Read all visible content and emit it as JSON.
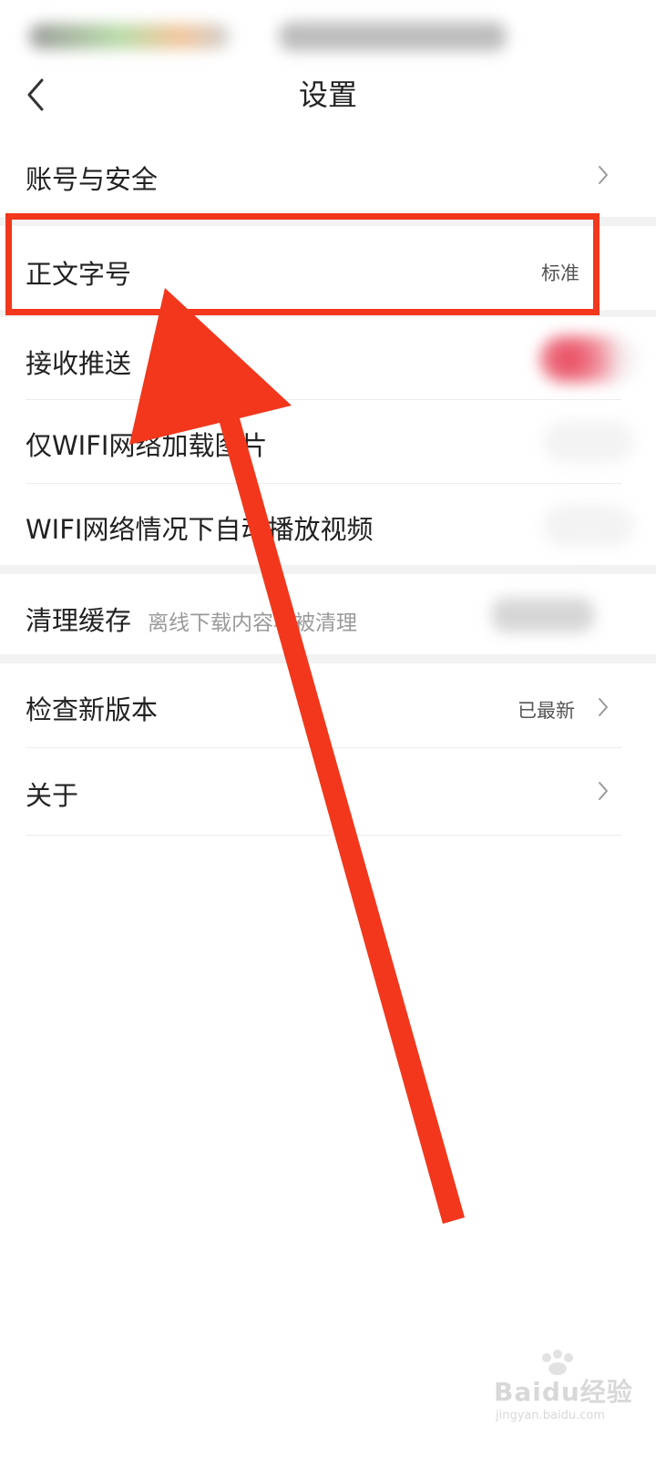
{
  "header": {
    "title": "设置"
  },
  "settings": {
    "account": {
      "label": "账号与安全"
    },
    "font_size": {
      "label": "正文字号",
      "value": "标准"
    },
    "push": {
      "label": "接收推送"
    },
    "wifi_images": {
      "label": "仅WIFI网络加载图片"
    },
    "wifi_video": {
      "label": "WIFI网络情况下自动播放视频"
    },
    "clear_cache": {
      "label": "清理缓存",
      "note": "离线下载内容将被清理"
    },
    "check_update": {
      "label": "检查新版本",
      "value": "已最新"
    },
    "about": {
      "label": "关于"
    }
  },
  "watermark": {
    "main": "Baidu经验",
    "sub": "jingyan.baidu.com"
  },
  "colors": {
    "annotation_red": "#f2371c",
    "toggle_on": "#e8445a",
    "section_gap": "#f2f2f2"
  },
  "icons": {
    "back": "back-chevron-icon",
    "chevron": "chevron-right-icon"
  }
}
